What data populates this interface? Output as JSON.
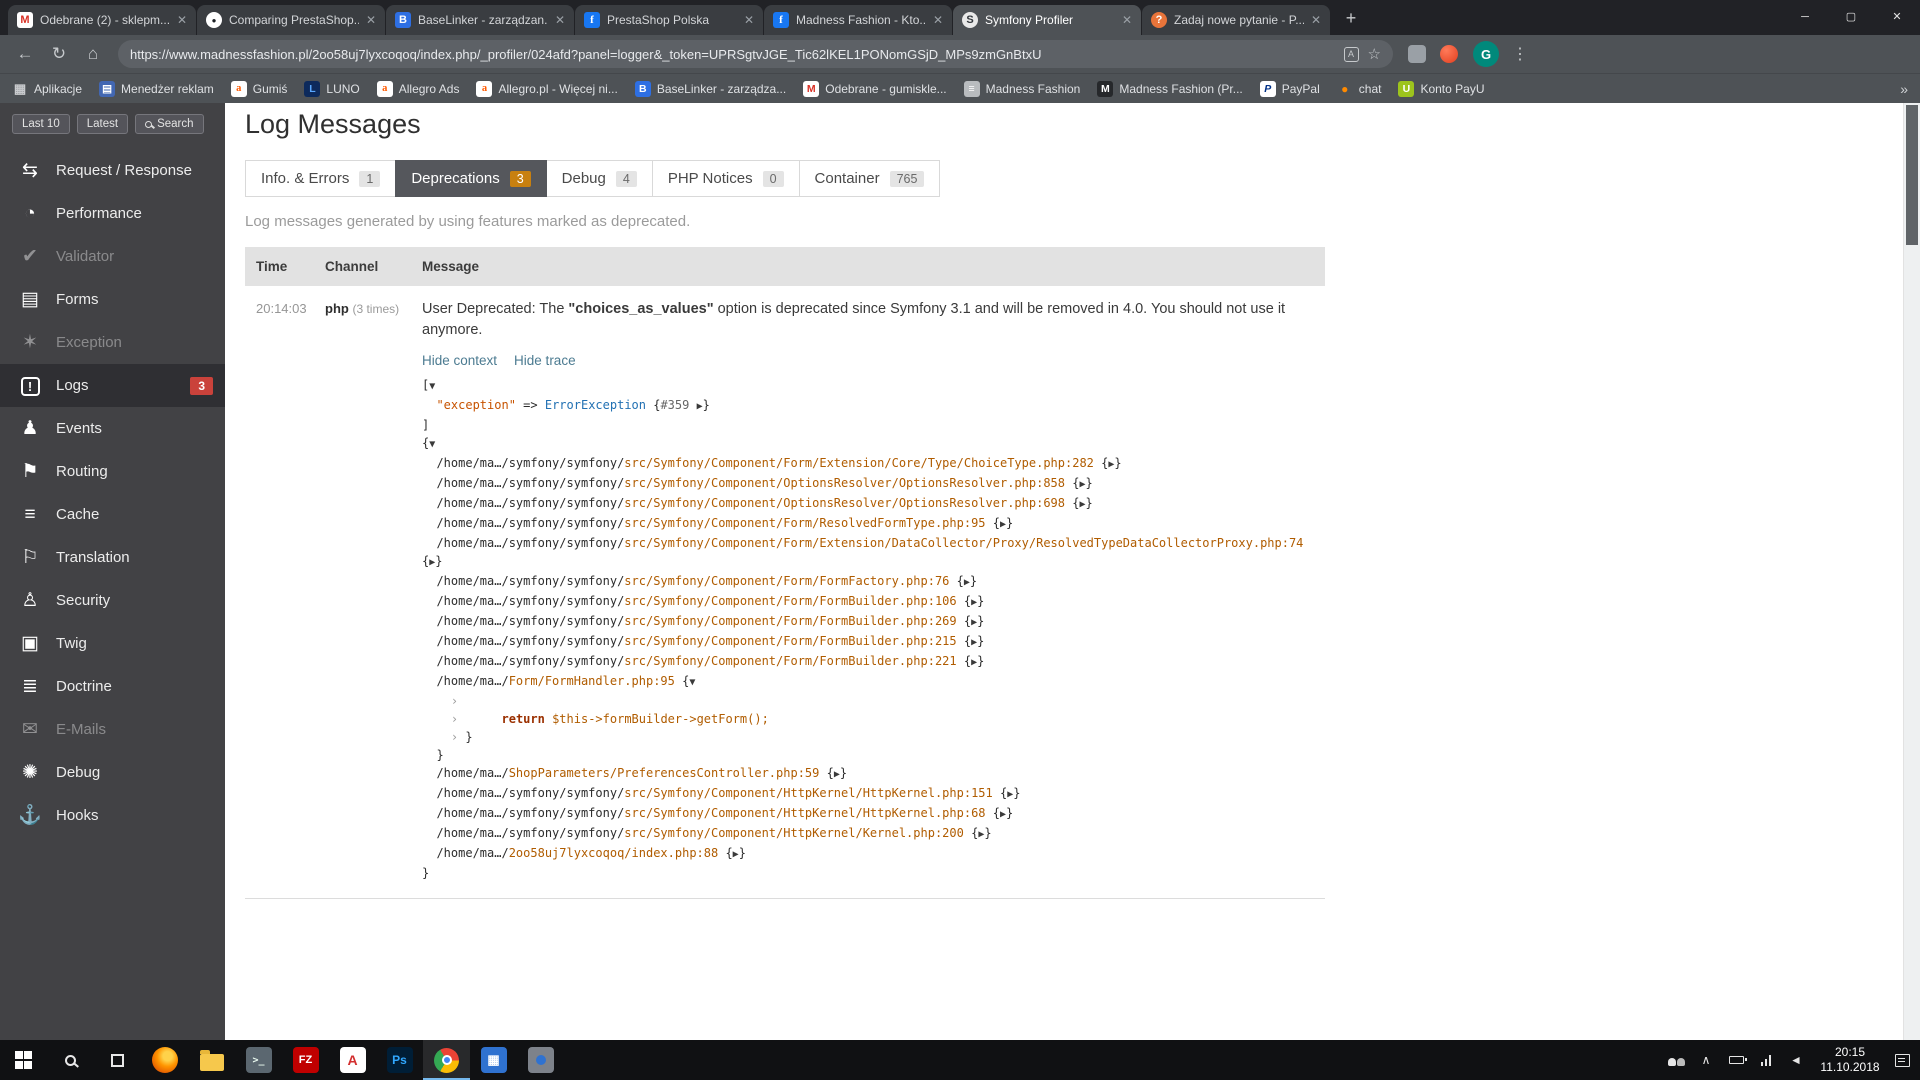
{
  "icon_glyphs": {
    "minimize": "─",
    "maximize": "▢",
    "close": "✕",
    "close_small": "✕",
    "new_tab": "+",
    "back": "←",
    "reload": "↻",
    "home": "⌂",
    "translate": "A",
    "star": "☆",
    "menu": "⋮",
    "overflow": "»"
  },
  "sidebar_icon_glyphs": {
    "request-response": "⇆",
    "performance": "◔",
    "validator": "✔",
    "forms": "▤",
    "exception": "✶",
    "logs": "!",
    "events": "♟",
    "routing": "⚑",
    "cache": "≡",
    "translation": "⚐",
    "security": "♙",
    "twig": "▣",
    "doctrine": "≣",
    "emails": "✉",
    "debug": "✺",
    "hooks": "⚓"
  },
  "colors": {
    "deprecation_badge": "#c8800f",
    "logs_badge": "#ca423b",
    "active_tab_bg": "#55575c"
  },
  "browser": {
    "tabs": [
      {
        "title": "Odebrane (2) - sklepm...",
        "icon": "gmail",
        "active": false
      },
      {
        "title": "Comparing PrestaShop...",
        "icon": "github",
        "active": false
      },
      {
        "title": "BaseLinker - zarządzan...",
        "icon": "baselinker",
        "active": false
      },
      {
        "title": "PrestaShop Polska",
        "icon": "facebook",
        "active": false
      },
      {
        "title": "Madness Fashion - Kto...",
        "icon": "facebook",
        "active": false
      },
      {
        "title": "Symfony Profiler",
        "icon": "symfony",
        "active": true
      },
      {
        "title": "Zadaj nowe pytanie - P...",
        "icon": "forum",
        "active": false
      }
    ],
    "url": "https://www.madnessfashion.pl/2oo58uj7lyxcoqoq/index.php/_profiler/024afd?panel=logger&_token=UPRSgtvJGE_Tic62lKEL1PONomGSjD_MPs9zmGnBtxU",
    "avatar_letter": "G",
    "bookmarks": [
      {
        "label": "Aplikacje",
        "icon": "apps"
      },
      {
        "label": "Menedżer reklam",
        "icon": "ads"
      },
      {
        "label": "Gumiś",
        "icon": "allegro"
      },
      {
        "label": "LUNO",
        "icon": "luno"
      },
      {
        "label": "Allegro Ads",
        "icon": "allegro"
      },
      {
        "label": "Allegro.pl - Więcej ni...",
        "icon": "allegro"
      },
      {
        "label": "BaseLinker - zarządza...",
        "icon": "baselinker"
      },
      {
        "label": "Odebrane - gumiskle...",
        "icon": "gmail"
      },
      {
        "label": "Madness Fashion",
        "icon": "doc"
      },
      {
        "label": "Madness Fashion (Pr...",
        "icon": "madness"
      },
      {
        "label": "PayPal",
        "icon": "paypal"
      },
      {
        "label": "chat",
        "icon": "chat"
      },
      {
        "label": "Konto PayU",
        "icon": "payu"
      }
    ]
  },
  "profiler": {
    "sidebar": {
      "buttons": [
        {
          "label": "Last 10"
        },
        {
          "label": "Latest"
        },
        {
          "label": "Search",
          "icon": "search"
        }
      ],
      "items": [
        {
          "label": "Request / Response",
          "icon": "request-response"
        },
        {
          "label": "Performance",
          "icon": "performance"
        },
        {
          "label": "Validator",
          "icon": "validator",
          "dimmed": true
        },
        {
          "label": "Forms",
          "icon": "forms"
        },
        {
          "label": "Exception",
          "icon": "exception",
          "dimmed": true
        },
        {
          "label": "Logs",
          "icon": "logs",
          "active": true,
          "badge": "3"
        },
        {
          "label": "Events",
          "icon": "events"
        },
        {
          "label": "Routing",
          "icon": "routing"
        },
        {
          "label": "Cache",
          "icon": "cache"
        },
        {
          "label": "Translation",
          "icon": "translation"
        },
        {
          "label": "Security",
          "icon": "security"
        },
        {
          "label": "Twig",
          "icon": "twig"
        },
        {
          "label": "Doctrine",
          "icon": "doctrine"
        },
        {
          "label": "E-Mails",
          "icon": "emails",
          "dimmed": true
        },
        {
          "label": "Debug",
          "icon": "debug"
        },
        {
          "label": "Hooks",
          "icon": "hooks"
        }
      ]
    },
    "page_title": "Log Messages",
    "tabs": [
      {
        "label": "Info. & Errors",
        "count": "1"
      },
      {
        "label": "Deprecations",
        "count": "3",
        "active": true
      },
      {
        "label": "Debug",
        "count": "4"
      },
      {
        "label": "PHP Notices",
        "count": "0"
      },
      {
        "label": "Container",
        "count": "765"
      }
    ],
    "description": "Log messages generated by using features marked as deprecated.",
    "table": {
      "headers": [
        "Time",
        "Channel",
        "Message"
      ]
    },
    "log": {
      "time": "20:14:03",
      "channel": "php",
      "channel_times": "(3 times)",
      "message_pre": "User Deprecated: The ",
      "message_bold": "\"choices_as_values\"",
      "message_post": " option is deprecated since Symfony 3.1 and will be removed in 4.0. You should not use it anymore.",
      "links": [
        "Hide context",
        "Hide trace"
      ],
      "dump": [
        [
          [
            "pl",
            "["
          ],
          [
            "tg",
            "▼"
          ]
        ],
        [
          [
            "pl",
            "  "
          ],
          [
            "str",
            "\"exception\""
          ],
          [
            "pl",
            " => "
          ],
          [
            "cls",
            "ErrorException"
          ],
          [
            "pl",
            " {"
          ],
          [
            "ref",
            "#359"
          ],
          [
            "pl",
            " "
          ],
          [
            "tg",
            "▶"
          ],
          [
            "pl",
            "}"
          ]
        ],
        [
          [
            "pl",
            "]"
          ]
        ],
        [
          [
            "pl",
            "{"
          ],
          [
            "tg",
            "▼"
          ]
        ],
        [
          [
            "pl",
            "  "
          ],
          [
            "pfx",
            "/home/ma…/symfony/symfony/"
          ],
          [
            "pth",
            "src/Symfony/Component/Form/Extension/Core/Type/ChoiceType.php:282"
          ],
          [
            "pl",
            " {"
          ],
          [
            "tg",
            "▶"
          ],
          [
            "pl",
            "}"
          ]
        ],
        [
          [
            "pl",
            "  "
          ],
          [
            "pfx",
            "/home/ma…/symfony/symfony/"
          ],
          [
            "pth",
            "src/Symfony/Component/OptionsResolver/OptionsResolver.php:858"
          ],
          [
            "pl",
            " {"
          ],
          [
            "tg",
            "▶"
          ],
          [
            "pl",
            "}"
          ]
        ],
        [
          [
            "pl",
            "  "
          ],
          [
            "pfx",
            "/home/ma…/symfony/symfony/"
          ],
          [
            "pth",
            "src/Symfony/Component/OptionsResolver/OptionsResolver.php:698"
          ],
          [
            "pl",
            " {"
          ],
          [
            "tg",
            "▶"
          ],
          [
            "pl",
            "}"
          ]
        ],
        [
          [
            "pl",
            "  "
          ],
          [
            "pfx",
            "/home/ma…/symfony/symfony/"
          ],
          [
            "pth",
            "src/Symfony/Component/Form/ResolvedFormType.php:95"
          ],
          [
            "pl",
            " {"
          ],
          [
            "tg",
            "▶"
          ],
          [
            "pl",
            "}"
          ]
        ],
        [
          [
            "pl",
            "  "
          ],
          [
            "pfx",
            "/home/ma…/symfony/symfony/"
          ],
          [
            "pth",
            "src/Symfony/Component/Form/Extension/DataCollector/Proxy/ResolvedTypeDataCollectorProxy.php:74"
          ],
          [
            "pl",
            " {"
          ],
          [
            "tg",
            "▶"
          ],
          [
            "pl",
            "}"
          ]
        ],
        [
          [
            "pl",
            "  "
          ],
          [
            "pfx",
            "/home/ma…/symfony/symfony/"
          ],
          [
            "pth",
            "src/Symfony/Component/Form/FormFactory.php:76"
          ],
          [
            "pl",
            " {"
          ],
          [
            "tg",
            "▶"
          ],
          [
            "pl",
            "}"
          ]
        ],
        [
          [
            "pl",
            "  "
          ],
          [
            "pfx",
            "/home/ma…/symfony/symfony/"
          ],
          [
            "pth",
            "src/Symfony/Component/Form/FormBuilder.php:106"
          ],
          [
            "pl",
            " {"
          ],
          [
            "tg",
            "▶"
          ],
          [
            "pl",
            "}"
          ]
        ],
        [
          [
            "pl",
            "  "
          ],
          [
            "pfx",
            "/home/ma…/symfony/symfony/"
          ],
          [
            "pth",
            "src/Symfony/Component/Form/FormBuilder.php:269"
          ],
          [
            "pl",
            " {"
          ],
          [
            "tg",
            "▶"
          ],
          [
            "pl",
            "}"
          ]
        ],
        [
          [
            "pl",
            "  "
          ],
          [
            "pfx",
            "/home/ma…/symfony/symfony/"
          ],
          [
            "pth",
            "src/Symfony/Component/Form/FormBuilder.php:215"
          ],
          [
            "pl",
            " {"
          ],
          [
            "tg",
            "▶"
          ],
          [
            "pl",
            "}"
          ]
        ],
        [
          [
            "pl",
            "  "
          ],
          [
            "pfx",
            "/home/ma…/symfony/symfony/"
          ],
          [
            "pth",
            "src/Symfony/Component/Form/FormBuilder.php:221"
          ],
          [
            "pl",
            " {"
          ],
          [
            "tg",
            "▶"
          ],
          [
            "pl",
            "}"
          ]
        ],
        [
          [
            "pl",
            "  "
          ],
          [
            "pfx",
            "/home/ma…/"
          ],
          [
            "pth",
            "Form/FormHandler.php:95"
          ],
          [
            "pl",
            " {"
          ],
          [
            "tg",
            "▼"
          ]
        ],
        [
          [
            "pl",
            "    "
          ],
          [
            "chev",
            "›"
          ]
        ],
        [
          [
            "pl",
            "    "
          ],
          [
            "chev",
            "›"
          ],
          [
            "pl",
            "      "
          ],
          [
            "kw",
            "return"
          ],
          [
            "pth",
            " $this->formBuilder->getForm();"
          ]
        ],
        [
          [
            "pl",
            "    "
          ],
          [
            "chev",
            "›"
          ],
          [
            "pl",
            " }"
          ]
        ],
        [
          [
            "pl",
            "  }"
          ]
        ],
        [
          [
            "pl",
            "  "
          ],
          [
            "pfx",
            "/home/ma…/"
          ],
          [
            "pth",
            "ShopParameters/PreferencesController.php:59"
          ],
          [
            "pl",
            " {"
          ],
          [
            "tg",
            "▶"
          ],
          [
            "pl",
            "}"
          ]
        ],
        [
          [
            "pl",
            "  "
          ],
          [
            "pfx",
            "/home/ma…/symfony/symfony/"
          ],
          [
            "pth",
            "src/Symfony/Component/HttpKernel/HttpKernel.php:151"
          ],
          [
            "pl",
            " {"
          ],
          [
            "tg",
            "▶"
          ],
          [
            "pl",
            "}"
          ]
        ],
        [
          [
            "pl",
            "  "
          ],
          [
            "pfx",
            "/home/ma…/symfony/symfony/"
          ],
          [
            "pth",
            "src/Symfony/Component/HttpKernel/HttpKernel.php:68"
          ],
          [
            "pl",
            " {"
          ],
          [
            "tg",
            "▶"
          ],
          [
            "pl",
            "}"
          ]
        ],
        [
          [
            "pl",
            "  "
          ],
          [
            "pfx",
            "/home/ma…/symfony/symfony/"
          ],
          [
            "pth",
            "src/Symfony/Component/HttpKernel/Kernel.php:200"
          ],
          [
            "pl",
            " {"
          ],
          [
            "tg",
            "▶"
          ],
          [
            "pl",
            "}"
          ]
        ],
        [
          [
            "pl",
            "  "
          ],
          [
            "pfx",
            "/home/ma…/"
          ],
          [
            "pth",
            "2oo58uj7lyxcoqoq/index.php:88"
          ],
          [
            "pl",
            " {"
          ],
          [
            "tg",
            "▶"
          ],
          [
            "pl",
            "}"
          ]
        ],
        [
          [
            "pl",
            "}"
          ]
        ]
      ]
    }
  },
  "taskbar": {
    "apps": [
      {
        "name": "start"
      },
      {
        "name": "search"
      },
      {
        "name": "task-view"
      },
      {
        "name": "firefox"
      },
      {
        "name": "explorer"
      },
      {
        "name": "terminal",
        "label": ">_"
      },
      {
        "name": "filezilla",
        "label": "FZ"
      },
      {
        "name": "acrobat",
        "label": "A"
      },
      {
        "name": "photoshop",
        "label": "Ps"
      },
      {
        "name": "chrome",
        "active": true
      },
      {
        "name": "calculator",
        "label": "▦"
      },
      {
        "name": "generic-app"
      }
    ],
    "time": "20:15",
    "date": "11.10.2018"
  }
}
